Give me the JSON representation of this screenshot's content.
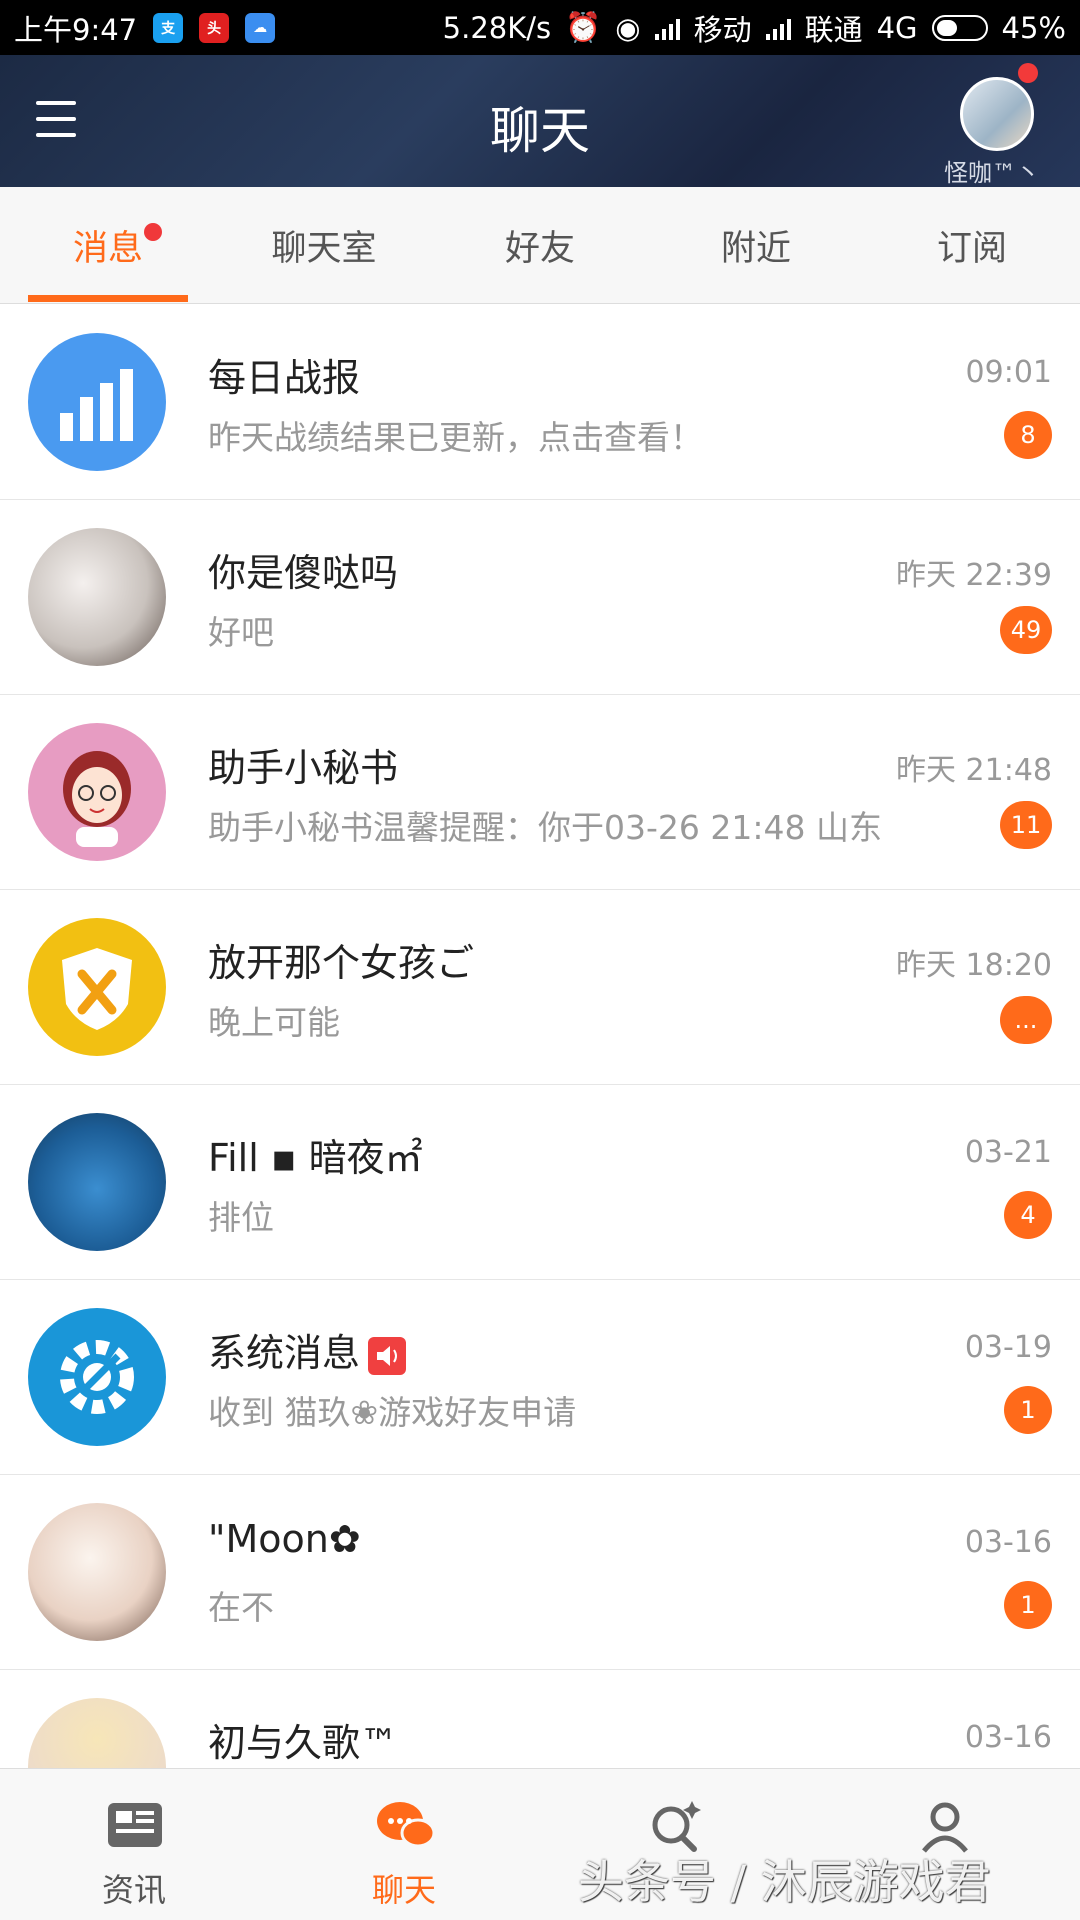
{
  "status_bar": {
    "time": "上午9:47",
    "speed": "5.28K/s",
    "carrier1": "移动",
    "carrier2": "联通",
    "network": "4G",
    "battery": "45%",
    "battery_level": 0.45,
    "app_icons": [
      "alipay-icon",
      "toutiao-icon",
      "cloud-icon"
    ]
  },
  "header": {
    "title": "聊天",
    "username": "怪咖™丶"
  },
  "tabs": [
    {
      "label": "消息",
      "active": true,
      "dot": true
    },
    {
      "label": "聊天室",
      "active": false
    },
    {
      "label": "好友",
      "active": false
    },
    {
      "label": "附近",
      "active": false
    },
    {
      "label": "订阅",
      "active": false
    }
  ],
  "conversations": [
    {
      "name": "每日战报",
      "preview": "昨天战绩结果已更新，点击查看！",
      "time": "09:01",
      "badge": "8",
      "avatar": "chart-icon"
    },
    {
      "name": "你是傻哒吗",
      "preview": "好吧",
      "time": "昨天  22:39",
      "badge": "49",
      "avatar": "couple-photo"
    },
    {
      "name": "助手小秘书",
      "preview": "助手小秘书温馨提醒：你于03-26 21:48 山东",
      "time": "昨天  21:48",
      "badge": "11",
      "avatar": "assistant-girl-icon"
    },
    {
      "name": "放开那个女孩ご",
      "preview": "晚上可能",
      "time": "昨天  18:20",
      "badge": "...",
      "avatar": "shield-icon"
    },
    {
      "name": "Fill ▪ 暗夜㎡",
      "preview": "排位",
      "time": "03-21",
      "badge": "4",
      "avatar": "boy-photo"
    },
    {
      "name": "系统消息",
      "preview": "收到 猫玖❀游戏好友申请",
      "time": "03-19",
      "badge": "1",
      "avatar": "settings-wrench-icon"
    },
    {
      "name": "\"Moon✿",
      "preview": "在不",
      "time": "03-16",
      "badge": "1",
      "avatar": "girl-photo"
    },
    {
      "name": "初与久歌™",
      "preview": "",
      "time": "03-16",
      "badge": "",
      "avatar": "anime-photo"
    }
  ],
  "bottom_nav": [
    {
      "label": "资讯",
      "icon": "news-icon",
      "active": false
    },
    {
      "label": "聊天",
      "icon": "chat-icon",
      "active": true
    },
    {
      "label": "",
      "icon": "discover-icon",
      "active": false
    },
    {
      "label": "",
      "icon": "profile-icon",
      "active": false
    }
  ],
  "watermark": "头条号 / 沐辰游戏君",
  "colors": {
    "accent": "#ff6a1a",
    "header_bg": "#1f2d48",
    "badge": "#ff6a1a",
    "dot": "#f0383a"
  }
}
